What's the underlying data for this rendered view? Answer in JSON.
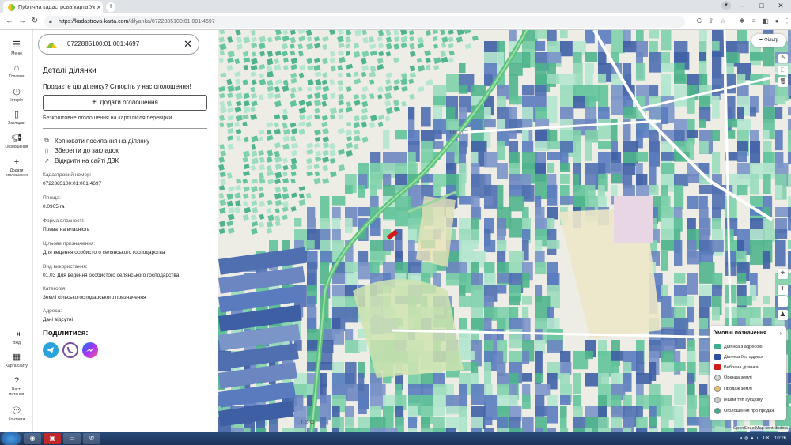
{
  "browser": {
    "tab_title": "Публічна кадастрова карта Укр",
    "tab_close": "✕",
    "new_tab": "+",
    "url_host": "https://kadastrova-karta.com",
    "url_path": "/dilyanka/0722885100:01:001:4697"
  },
  "rail": {
    "menu": "Меню",
    "home": "Головна",
    "history": "Історія",
    "bookmarks": "Закладки",
    "ads": "Оголошення",
    "add_ad": "Додати оголошення",
    "login": "Вхід",
    "sitemap": "Карта сайту",
    "faq": "Часті питання",
    "contacts": "Контакти"
  },
  "panel": {
    "search_value": "0722885100:01:001:4697",
    "title": "Деталі ділянки",
    "promo": "Продаєте цю ділянку? Створіть у нас оголошення!",
    "add_button": "Додати оголошення",
    "free_note": "Безкоштовне оголошення на карті після перевірки",
    "actions": {
      "copy": "Копіювати посилання на ділянку",
      "save": "Зберегти до закладок",
      "open": "Відкрити на сайті ДЗК"
    },
    "fields": [
      {
        "label": "Кадастровий номер:",
        "value": "0722885100:01:001:4697"
      },
      {
        "label": "Площа:",
        "value": "0.0905 га"
      },
      {
        "label": "Форма власності:",
        "value": "Приватна власність"
      },
      {
        "label": "Цільове призначення:",
        "value": "Для ведення особистого селянського господарства"
      },
      {
        "label": "Вид використання:",
        "value": "01.03 Для ведення особистого селянського господарства"
      },
      {
        "label": "Категорія:",
        "value": "Землі сільськогосподарського призначення"
      },
      {
        "label": "Адреса:",
        "value": "Дані відсутні"
      }
    ],
    "share_title": "Поділитися:"
  },
  "map": {
    "filter": "Фільтр",
    "road_label_1": "Т-03-03",
    "road_label_2": "Т-03-03",
    "attribution": "OpenStreetMap contributors",
    "legend": {
      "title": "Умовні позначення",
      "items": [
        {
          "label": "Ділянка з адресою",
          "color": "#3fae8c"
        },
        {
          "label": "Ділянка без адреси",
          "color": "#2f4f9f"
        },
        {
          "label": "Вибрана ділянка",
          "color": "#d11c1c"
        },
        {
          "label": "Оренда землі",
          "color": "#cfd8d2"
        },
        {
          "label": "Продаж землі",
          "color": "#e8c46a"
        },
        {
          "label": "Інший тип аукціону",
          "color": "#c9c9c9"
        },
        {
          "label": "Оголошення про продаж",
          "color": "#3fae8c"
        }
      ]
    }
  },
  "taskbar": {
    "lang": "UK",
    "time": "10:26"
  }
}
